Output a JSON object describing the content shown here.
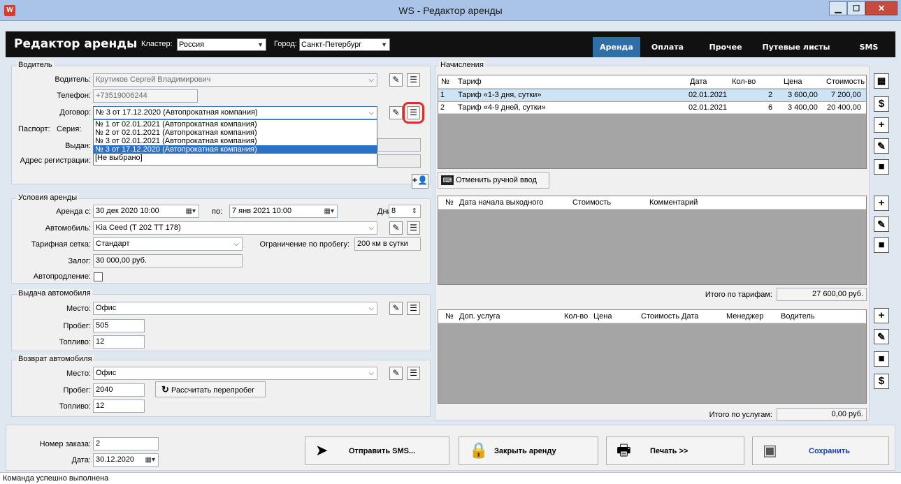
{
  "window": {
    "title": "WS - Редактор аренды",
    "app_icon": "W"
  },
  "header": {
    "title": "Редактор аренды",
    "cluster_label": "Кластер:",
    "cluster_value": "Россия",
    "city_label": "Город:",
    "city_value": "Санкт-Петербург",
    "tabs": [
      "Аренда",
      "Оплата",
      "Прочее",
      "Путевые листы",
      "SMS"
    ],
    "active_tab": "Аренда"
  },
  "driver": {
    "group_title": "Водитель",
    "driver_label": "Водитель:",
    "driver_value": "Крутиков Сергей Владимирович",
    "phone_label": "Телефон:",
    "phone_value": "+73519006244",
    "contract_label": "Договор:",
    "contract_value": "№ 3 от 17.12.2020 (Автопрокатная компания)",
    "contract_options": [
      "№ 1 от 02.01.2021 (Автопрокатная компания)",
      "№ 2 от 02.01.2021 (Автопрокатная компания)",
      "№ 3 от 02.01.2021 (Автопрокатная компания)",
      "№ 3 от 17.12.2020 (Автопрокатная компания)",
      "[Не выбрано]"
    ],
    "contract_selected_option": "№ 3 от 17.12.2020 (Автопрокатная компания)",
    "passport_label": "Паспорт:",
    "series_label": "Серия:",
    "issued_label": "Выдан:",
    "address_label": "Адрес регистрации:"
  },
  "conditions": {
    "group_title": "Условия аренды",
    "rent_from_label": "Аренда с:",
    "rent_from_value": "30 дек 2020  10:00",
    "rent_to_label": "по:",
    "rent_to_value": "7 янв 2021  10:00",
    "days_label": "Дни:",
    "days_value": "8",
    "car_label": "Автомобиль:",
    "car_value": "Kia Ceed (Т 202 ТТ 178)",
    "tariff_label": "Тарифная сетка:",
    "tariff_value": "Стандарт",
    "mileage_limit_label": "Ограничение по пробегу:",
    "mileage_limit_value": "200 км в сутки",
    "deposit_label": "Залог:",
    "deposit_value": "30 000,00 руб.",
    "autorenew_label": "Автопродление:",
    "autorenew_checked": false
  },
  "issue": {
    "group_title": "Выдача автомобиля",
    "place_label": "Место:",
    "place_value": "Офис",
    "mileage_label": "Пробег:",
    "mileage_value": "505",
    "fuel_label": "Топливо:",
    "fuel_value": "12"
  },
  "return": {
    "group_title": "Возврат автомобиля",
    "place_label": "Место:",
    "place_value": "Офис",
    "mileage_label": "Пробег:",
    "mileage_value": "2040",
    "fuel_label": "Топливо:",
    "fuel_value": "12",
    "recalc_label": "Рассчитать перепробег"
  },
  "charges": {
    "group_title": "Начисления",
    "columns": [
      "№",
      "Тариф",
      "Дата",
      "Кол-во",
      "Цена",
      "Стоимость"
    ],
    "rows": [
      [
        "1",
        "Тариф «1-3 дня, сутки»",
        "02.01.2021",
        "2",
        "3 600,00",
        "7 200,00"
      ],
      [
        "2",
        "Тариф «4-9 дней, сутки»",
        "02.01.2021",
        "6",
        "3 400,00",
        "20 400,00"
      ]
    ],
    "cancel_manual_label": "Отменить ручной ввод"
  },
  "weekends": {
    "columns": [
      "№",
      "Дата начала выходного",
      "Стоимость",
      "Комментарий"
    ],
    "total_label": "Итого по тарифам:",
    "total_value": "27 600,00 руб."
  },
  "services": {
    "columns": [
      "№",
      "Доп. услуга",
      "Кол-во",
      "Цена",
      "Стоимость",
      "Дата",
      "Менеджер",
      "Водитель"
    ],
    "total_label": "Итого по услугам:",
    "total_value": "0,00 руб."
  },
  "footer": {
    "order_label": "Номер заказа:",
    "order_value": "2",
    "date_label": "Дата:",
    "date_value": "30.12.2020",
    "send_sms_label": "Отправить SMS...",
    "close_rent_label": "Закрыть аренду",
    "print_label": "Печать  >>",
    "save_label": "Сохранить",
    "save_color": "#1a3fb5"
  },
  "status": {
    "text": "Команда успешно выполнена"
  }
}
